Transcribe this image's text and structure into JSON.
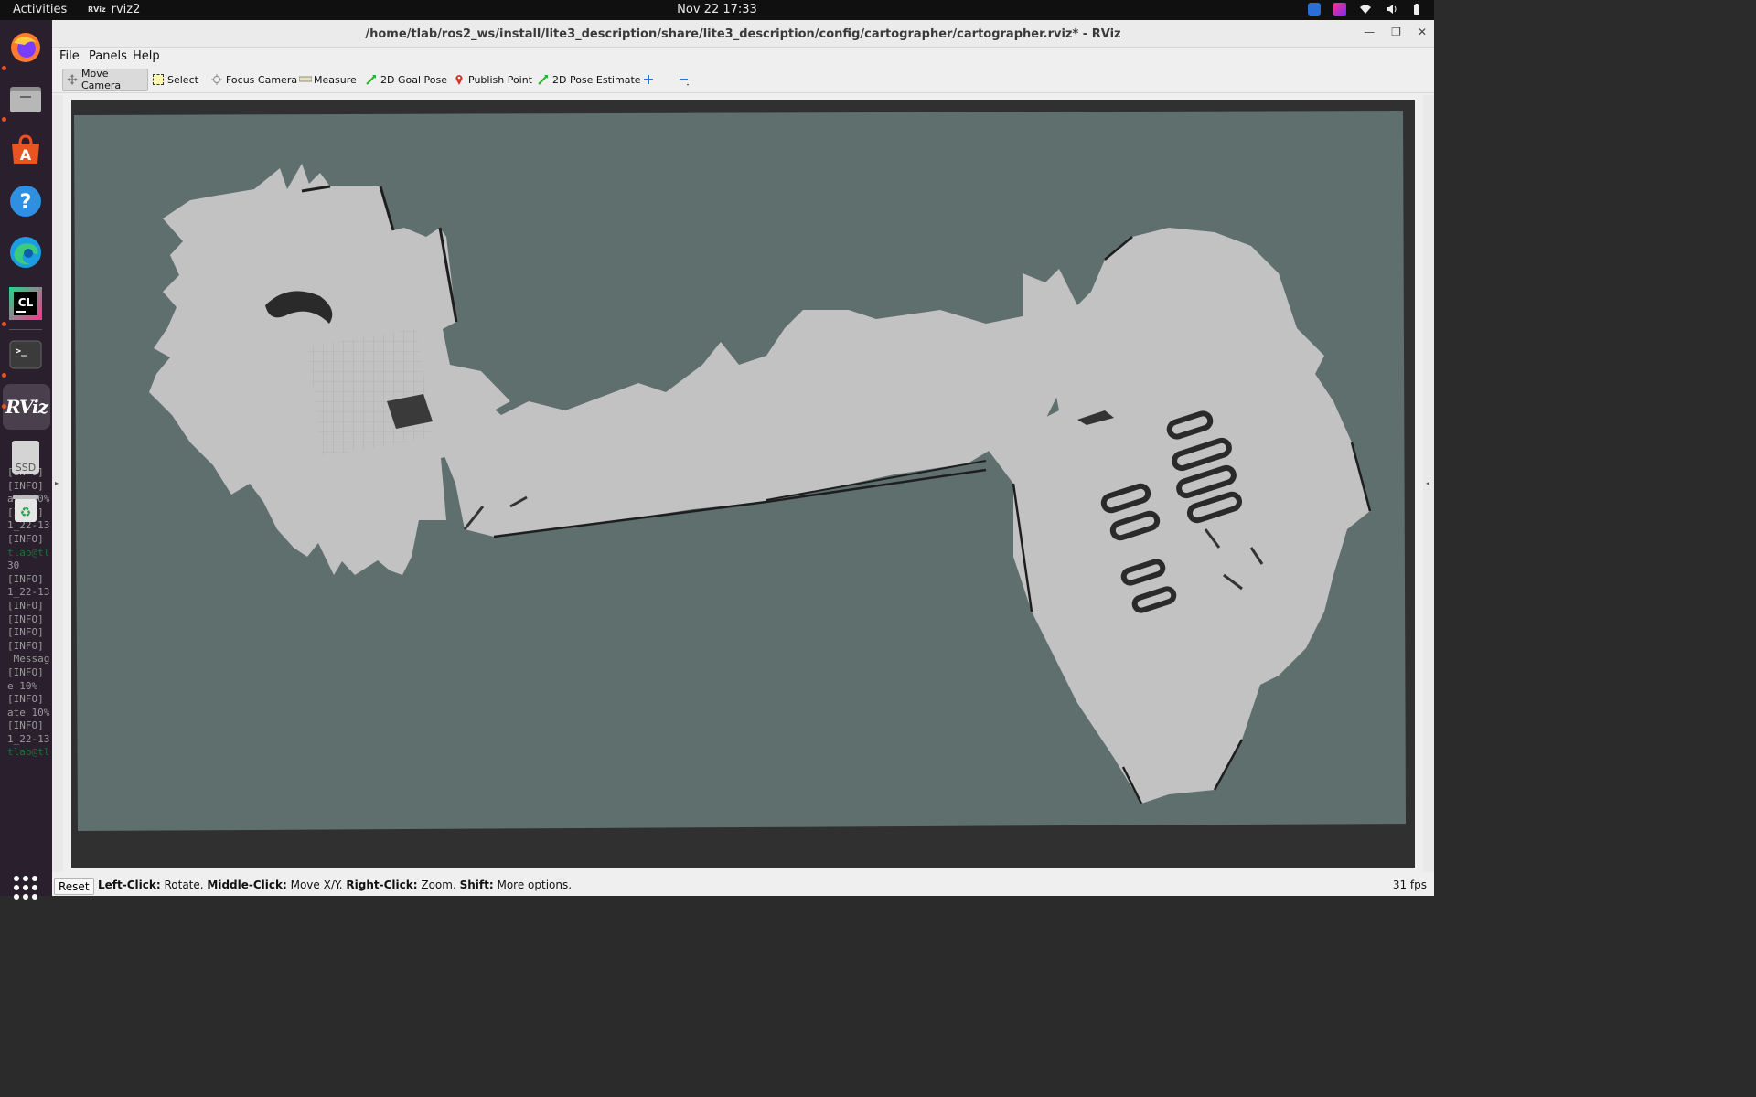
{
  "topbar": {
    "activities": "Activities",
    "app_name": "rviz2",
    "clock": "Nov 22  17:33"
  },
  "dock": {
    "items": [
      "firefox-icon",
      "files-icon",
      "app-center-icon",
      "help-icon",
      "edge-icon",
      "clion-icon",
      "terminal-icon",
      "rviz-icon",
      "ssd-drive-icon",
      "trash-icon"
    ],
    "ssd_label": "SSD",
    "rviz_label": "RViz",
    "clion_label": "CL",
    "terminal_lines": [
      "[INFO]",
      "[INFO]",
      "ate 10%",
      "[INFO]",
      "1_22-13",
      "[INFO]",
      "tlab@tl",
      "30",
      "[INFO]",
      "1_22-13",
      "[INFO]",
      "[INFO]",
      "[INFO]",
      "[INFO]",
      " Messag",
      "[INFO]",
      "e 10%",
      "[INFO]",
      "ate 10%",
      "[INFO]",
      "1_22-13",
      "tlab@tl"
    ]
  },
  "window": {
    "title": "/home/tlab/ros2_ws/install/lite3_description/share/lite3_description/config/cartographer/cartographer.rviz* - RViz"
  },
  "menubar": {
    "file": "File",
    "panels": "Panels",
    "help": "Help"
  },
  "toolbar": {
    "move_camera": "Move Camera",
    "select": "Select",
    "focus_camera": "Focus Camera",
    "measure": "Measure",
    "goal_pose": "2D Goal Pose",
    "publish_point": "Publish Point",
    "pose_estimate": "2D Pose Estimate"
  },
  "status": {
    "reset": "Reset",
    "left_click": "Left-Click:",
    "left_click_desc": " Rotate. ",
    "middle_click": "Middle-Click:",
    "middle_click_desc": " Move X/Y. ",
    "right_click": "Right-Click:",
    "right_click_desc": " Zoom. ",
    "shift": "Shift:",
    "shift_desc": " More options.",
    "fps": "31 fps"
  },
  "colors": {
    "map_unknown": "#5f6f6e",
    "map_free": "#c2c2c2",
    "map_occupied": "#222222",
    "viewport_bg": "#303030",
    "dock_bg": "#2a1f2c"
  }
}
